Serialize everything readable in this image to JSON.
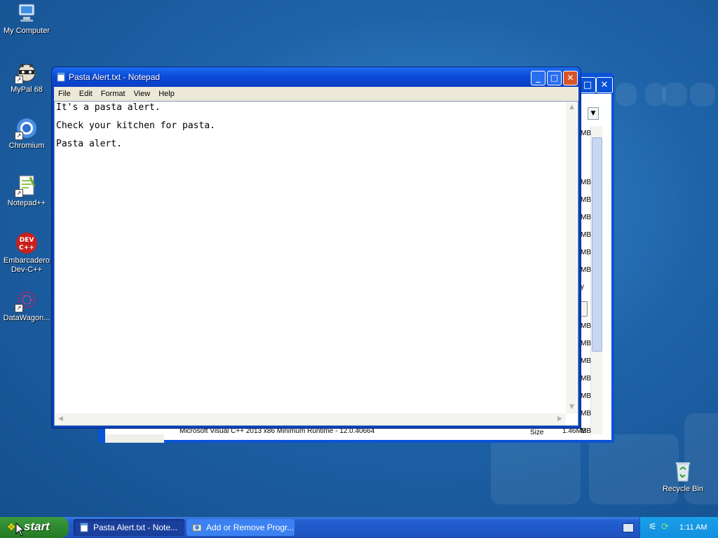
{
  "desktop": {
    "icons": [
      {
        "label": "My Computer",
        "icon": "computer-icon"
      },
      {
        "label": "MyPal 68",
        "icon": "raccoon-icon"
      },
      {
        "label": "Chromium",
        "icon": "chromium-icon"
      },
      {
        "label": "Notepad++",
        "icon": "notepadpp-icon"
      },
      {
        "label": "Embarcadero Dev-C++",
        "icon": "devcpp-icon"
      },
      {
        "label": "DataWagon...",
        "icon": "datawagon-icon"
      },
      {
        "label": "Recycle Bin",
        "icon": "recycle-bin-icon"
      }
    ]
  },
  "background_window": {
    "sizes": [
      "MB",
      "MB",
      "MB",
      "MB",
      "MB",
      "MB",
      "MB",
      "y",
      "e",
      "MB",
      "MB",
      "MB",
      "MB",
      "MB",
      "MB",
      "MB"
    ],
    "bottom_row": "Microsoft Visual C++ 2013 x86 Minimum Runtime - 12.0.40664",
    "bottom_size_label": "Size",
    "bottom_size_value": "1.46MB"
  },
  "notepad": {
    "title": "Pasta Alert.txt - Notepad",
    "menu": [
      "File",
      "Edit",
      "Format",
      "View",
      "Help"
    ],
    "lines": [
      "It's a pasta alert.",
      "Check your kitchen for pasta.",
      "Pasta alert."
    ]
  },
  "taskbar": {
    "start_label": "start",
    "items": [
      {
        "label": "Pasta Alert.txt - Note...",
        "active": true
      },
      {
        "label": "Add or Remove Progr...",
        "active": false
      }
    ],
    "clock": "1:11 AM"
  },
  "colors": {
    "accent": "#0a4cd8",
    "start_green": "#2f8a2f",
    "close_red": "#d8552a"
  }
}
